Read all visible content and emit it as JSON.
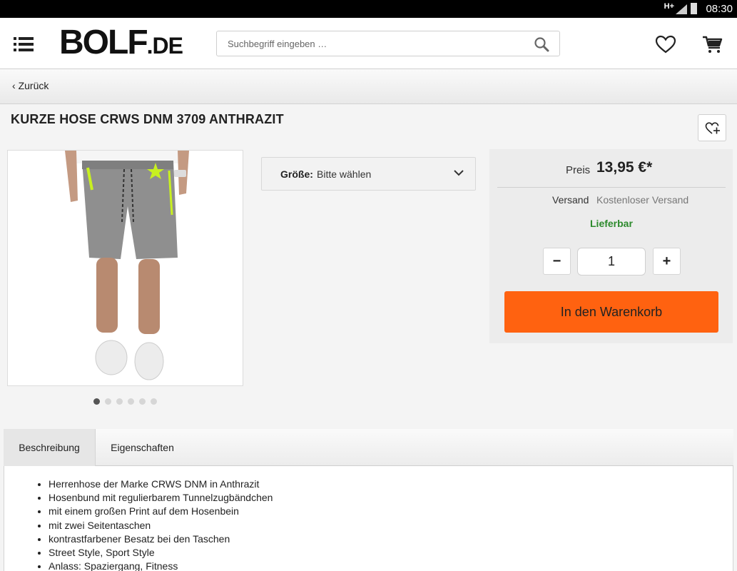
{
  "status": {
    "network": "H+",
    "time": "08:30"
  },
  "header": {
    "logo_big": "BOLF",
    "logo_small": ".DE",
    "search_placeholder": "Suchbegriff eingeben …"
  },
  "nav": {
    "back_label": "Zurück"
  },
  "product": {
    "title": "KURZE HOSE CRWS DNM 3709 ANTHRAZIT",
    "image_count": 6,
    "active_image": 1
  },
  "size": {
    "label": "Größe:",
    "value": "Bitte wählen"
  },
  "buybox": {
    "price_label": "Preis",
    "price": "13,95 €*",
    "shipping_label": "Versand",
    "shipping_value": "Kostenloser Versand",
    "availability": "Lieferbar",
    "quantity": "1",
    "minus": "−",
    "plus": "+",
    "cart_button": "In den Warenkorb"
  },
  "tabs": [
    {
      "label": "Beschreibung",
      "active": true
    },
    {
      "label": "Eigenschaften",
      "active": false
    }
  ],
  "description": [
    "Herrenhose der Marke CRWS DNM in Anthrazit",
    "Hosenbund mit regulierbarem Tunnelzugbändchen",
    "mit einem großen Print auf dem Hosenbein",
    "mit zwei Seitentaschen",
    "kontrastfarbener Besatz bei den Taschen",
    "Street Style, Sport Style",
    "Anlass: Spaziergang, Fitness"
  ],
  "colors": {
    "accent": "#ff6210",
    "available": "#2c8a2c",
    "neon": "#c8f020",
    "shorts": "#8f8f8f"
  }
}
